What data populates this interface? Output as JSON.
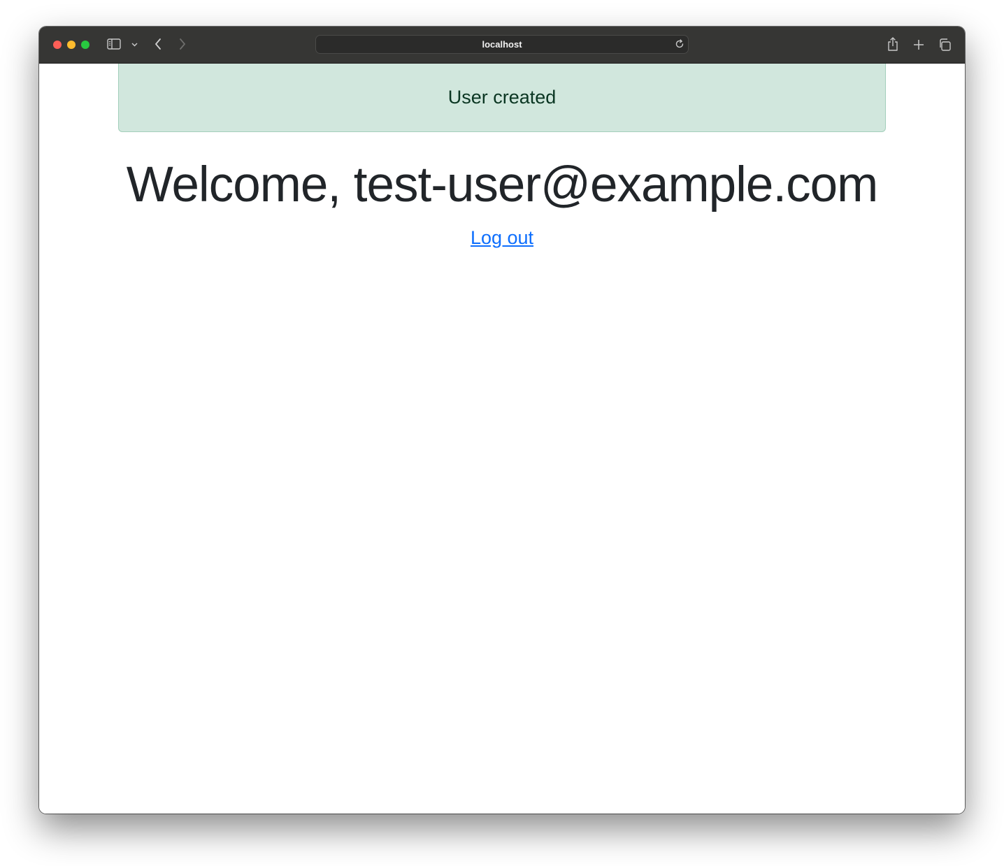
{
  "browser": {
    "url": "localhost",
    "icons": {
      "sidebar": "sidebar-icon",
      "sidebar_menu": "chevron-down-icon",
      "back": "back-arrow-icon",
      "forward": "forward-arrow-icon",
      "reload": "reload-icon",
      "share": "share-icon",
      "new_tab": "plus-icon",
      "tabs_overview": "tabs-overview-icon"
    }
  },
  "alert": {
    "message": "User created",
    "background": "#d1e7dd",
    "text_color": "#0a3622"
  },
  "main": {
    "welcome": "Welcome, test-user@example.com",
    "logout_label": "Log out",
    "link_color": "#0d6efd"
  }
}
